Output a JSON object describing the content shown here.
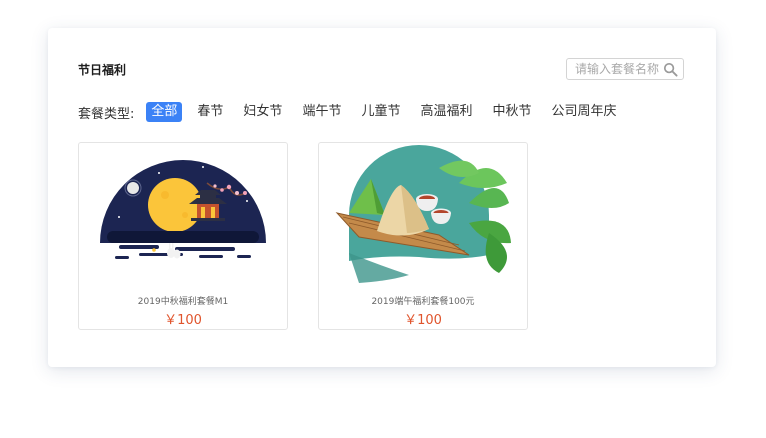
{
  "panel": {
    "title": "节日福利"
  },
  "search": {
    "placeholder": "请输入套餐名称"
  },
  "filter": {
    "label": "套餐类型:",
    "tags": [
      "全部",
      "春节",
      "妇女节",
      "端午节",
      "儿童节",
      "高温福利",
      "中秋节",
      "公司周年庆"
    ],
    "active": "全部"
  },
  "products": [
    {
      "name": "2019中秋福利套餐M1",
      "price": "￥100",
      "image_icon": "mid-autumn-moon-pavilion"
    },
    {
      "name": "2019端午福利套餐100元",
      "price": "￥100",
      "image_icon": "dragon-boat-zongzi-tea"
    }
  ],
  "colors": {
    "accent": "#3b82f6",
    "price": "#e0542c"
  }
}
